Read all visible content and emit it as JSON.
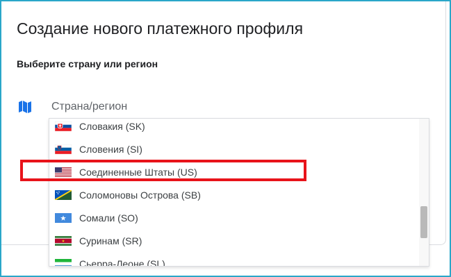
{
  "dialog": {
    "title": "Создание нового платежного профиля",
    "subtitle": "Выберите страну или регион",
    "field_icon": "map-icon",
    "field_label": "Страна/регион"
  },
  "dropdown": {
    "options": [
      {
        "label": "Словакия (SK)",
        "flag": "flag-sk-icon"
      },
      {
        "label": "Словения (SI)",
        "flag": "flag-si-icon"
      },
      {
        "label": "Соединенные Штаты (US)",
        "flag": "flag-us-icon"
      },
      {
        "label": "Соломоновы Острова (SB)",
        "flag": "flag-sb-icon"
      },
      {
        "label": "Сомали (SO)",
        "flag": "flag-so-icon"
      },
      {
        "label": "Суринам (SR)",
        "flag": "flag-sr-icon"
      },
      {
        "label": "Сьерра-Леоне (SL)",
        "flag": "flag-sl-icon"
      }
    ]
  },
  "annotation": {
    "highlight_color": "#e8131a",
    "highlighted_option": "Соединенные Штаты (US)"
  },
  "colors": {
    "frame": "#2aa7c9",
    "icon_blue": "#1a73e8"
  }
}
